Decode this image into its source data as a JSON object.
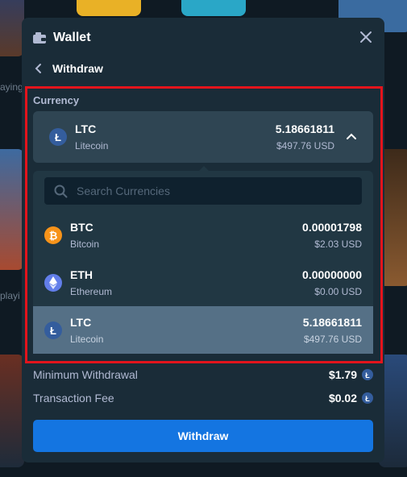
{
  "header": {
    "title": "Wallet",
    "back_label": "Withdraw"
  },
  "background": {
    "text1": "aying",
    "text2": "playi"
  },
  "currency": {
    "section_label": "Currency",
    "selected": {
      "code": "LTC",
      "name": "Litecoin",
      "amount": "5.18661811",
      "usd": "$497.76 USD"
    },
    "search_placeholder": "Search Currencies",
    "options": [
      {
        "code": "BTC",
        "name": "Bitcoin",
        "amount": "0.00001798",
        "usd": "$2.03 USD",
        "icon": "bitcoin-icon",
        "color": "#f7931a"
      },
      {
        "code": "ETH",
        "name": "Ethereum",
        "amount": "0.00000000",
        "usd": "$0.00 USD",
        "icon": "ethereum-icon",
        "color": "#627eea"
      },
      {
        "code": "LTC",
        "name": "Litecoin",
        "amount": "5.18661811",
        "usd": "$497.76 USD",
        "icon": "litecoin-icon",
        "color": "#345d9d"
      }
    ]
  },
  "details": {
    "min_withdrawal_label": "Minimum Withdrawal",
    "min_withdrawal_value": "$1.79",
    "fee_label": "Transaction Fee",
    "fee_value": "$0.02"
  },
  "withdraw_button": "Withdraw",
  "colors": {
    "accent": "#1475e1",
    "highlight": "#e3141c",
    "modal_bg": "#1a2c38"
  }
}
